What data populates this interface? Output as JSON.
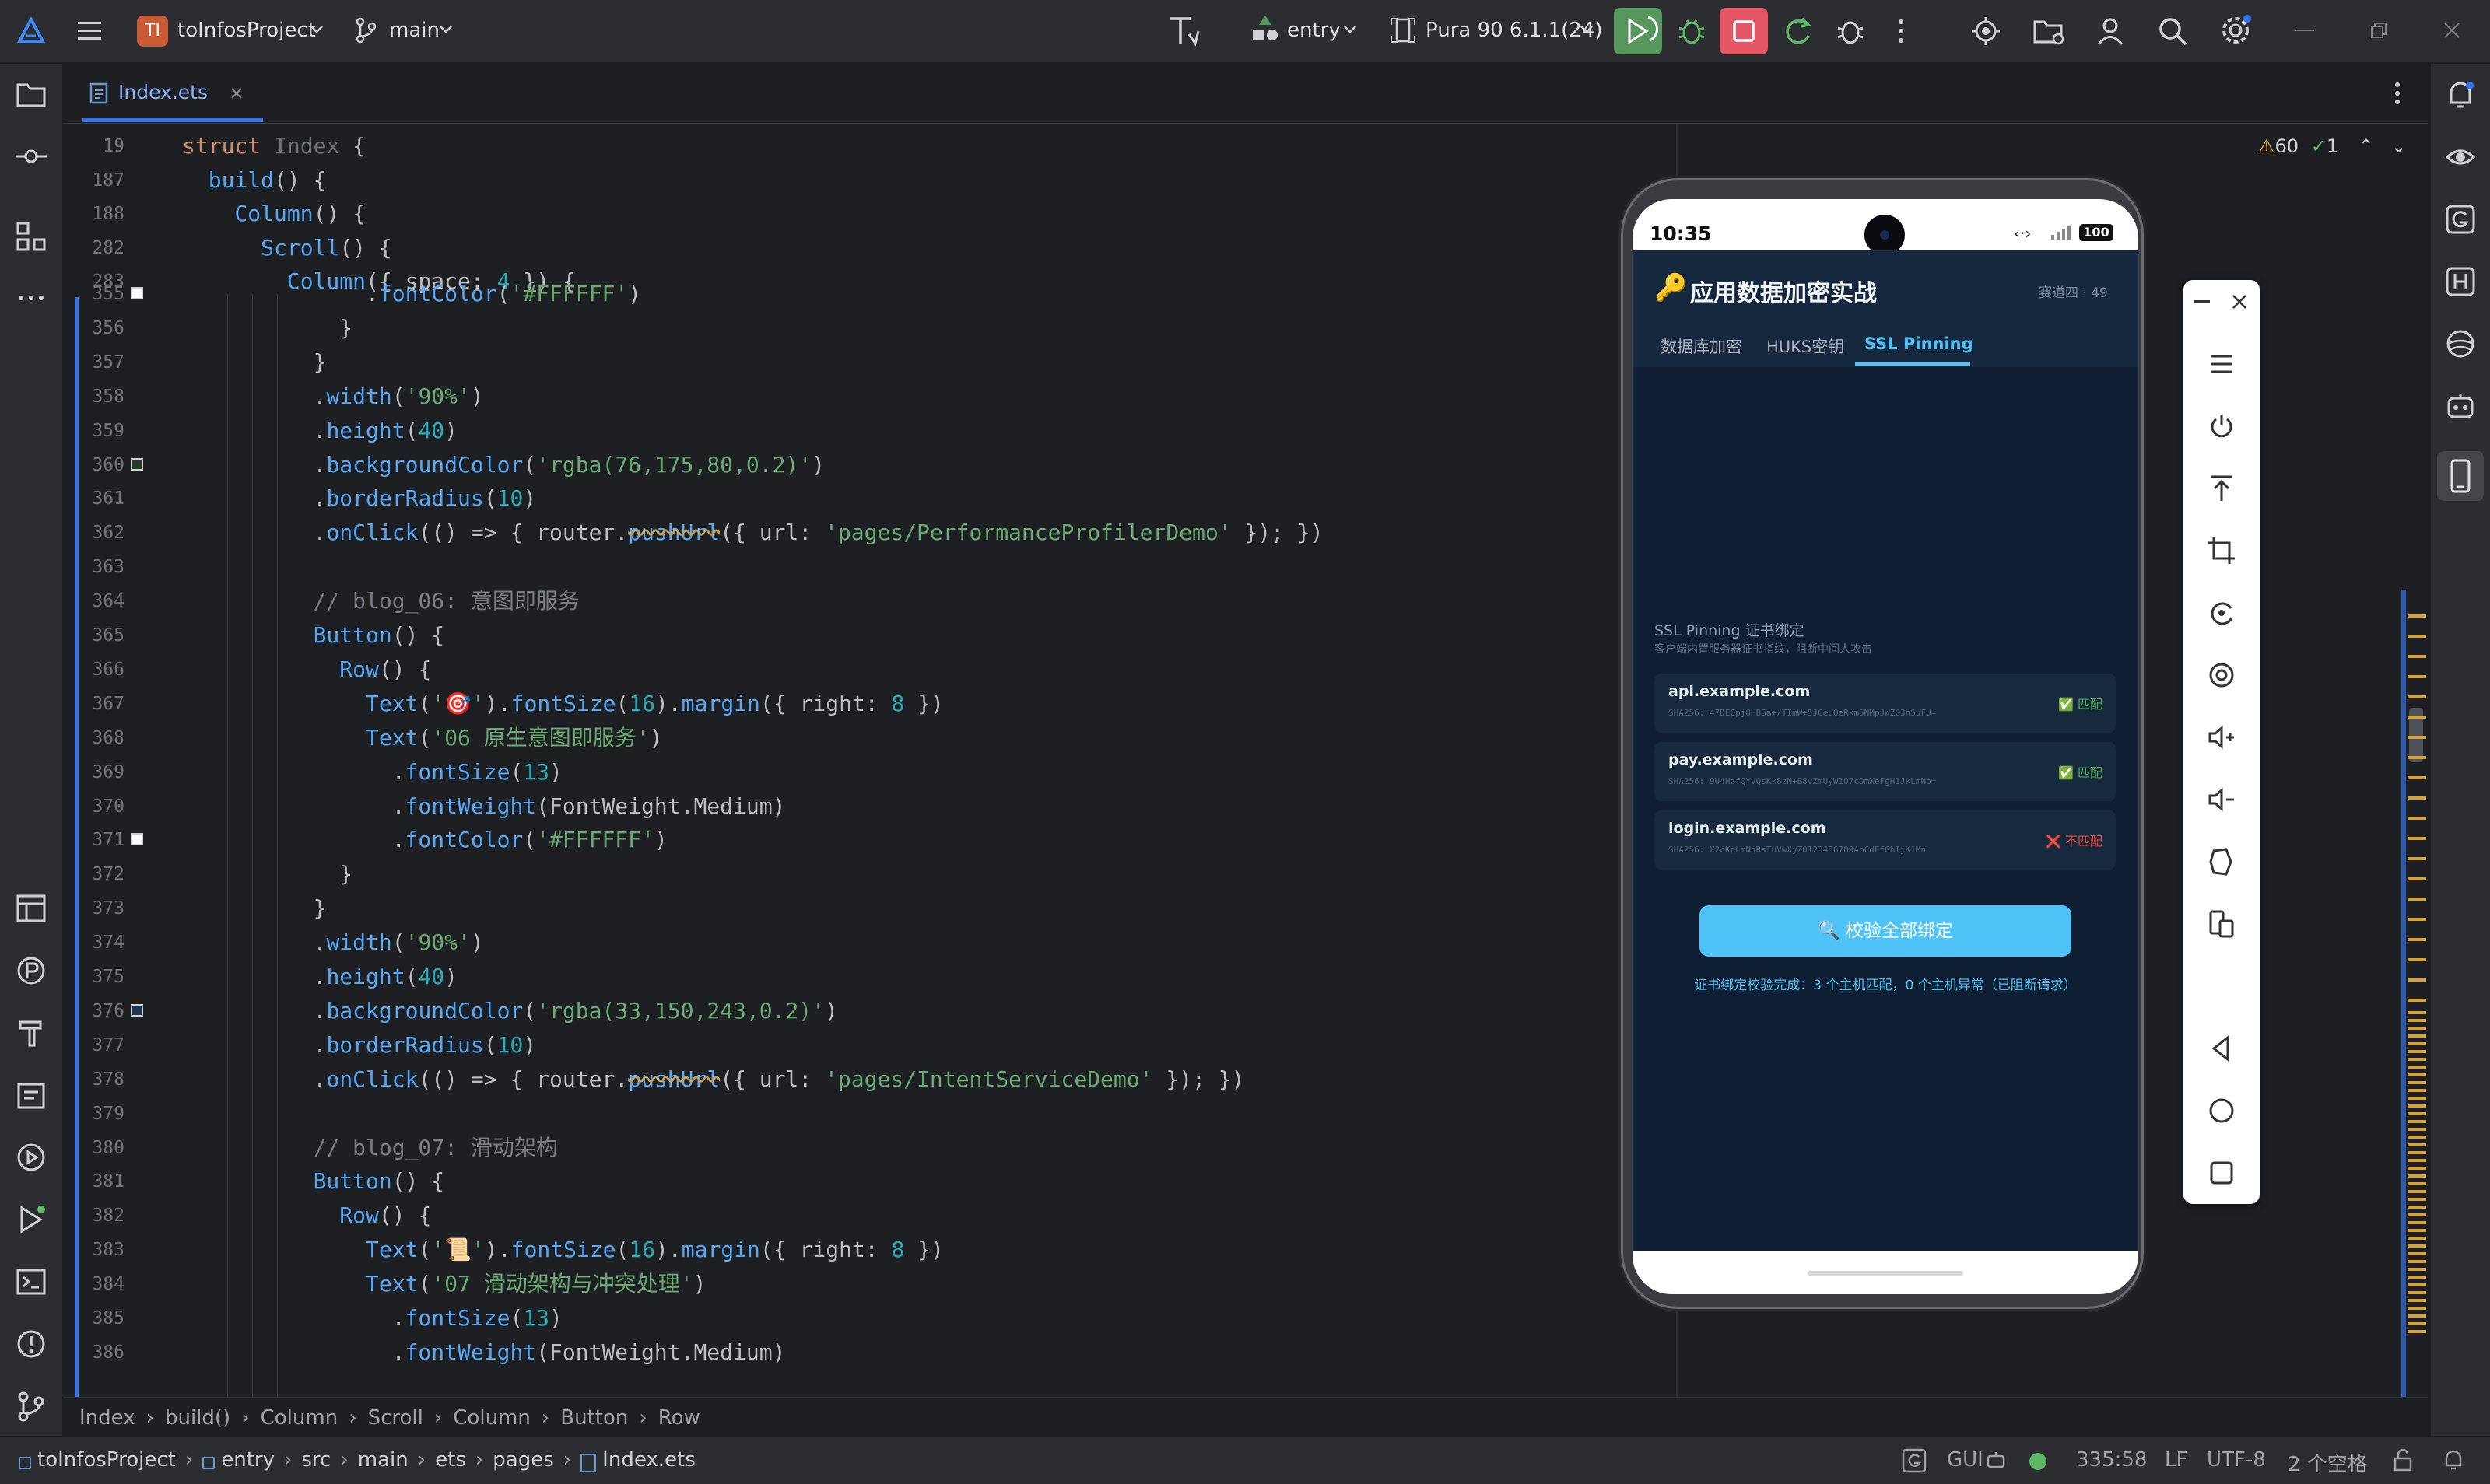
{
  "topbar": {
    "project_badge": "TI",
    "project_name": "toInfosProject",
    "branch": "main",
    "run_config": "entry",
    "device": "Pura 90 6.1.1(24)"
  },
  "editor_tab": {
    "filename": "Index.ets"
  },
  "inspections": {
    "warnings": "60",
    "ok": "1"
  },
  "sticky_lines": [
    {
      "num": "19",
      "parts": [
        [
          "kw",
          "struct "
        ],
        [
          "gr",
          "Index "
        ],
        [
          "",
          "{"
        ]
      ],
      "indent": 0
    },
    {
      "num": "187",
      "parts": [
        [
          "fn",
          "build"
        ],
        [
          "",
          "() {"
        ]
      ],
      "indent": 1
    },
    {
      "num": "188",
      "parts": [
        [
          "fn",
          "Column"
        ],
        [
          "",
          "() {"
        ]
      ],
      "indent": 2
    },
    {
      "num": "282",
      "parts": [
        [
          "fn",
          "Scroll"
        ],
        [
          "",
          "() {"
        ]
      ],
      "indent": 3
    },
    {
      "num": "283",
      "parts": [
        [
          "fn",
          "Column"
        ],
        [
          "",
          "({ space: "
        ],
        [
          "num",
          "4"
        ],
        [
          "",
          " }) {"
        ]
      ],
      "indent": 4
    }
  ],
  "code_lines": [
    {
      "num": "355",
      "parts": [
        [
          "",
          "      ."
        ],
        [
          "fn",
          "fontColor"
        ],
        [
          "",
          "("
        ],
        [
          "str",
          "'#FFFFFF'"
        ],
        [
          "",
          ")"
        ]
      ],
      "gutter": "white"
    },
    {
      "num": "356",
      "parts": [
        [
          "",
          "    }"
        ]
      ]
    },
    {
      "num": "357",
      "parts": [
        [
          "",
          "  }"
        ]
      ]
    },
    {
      "num": "358",
      "parts": [
        [
          "",
          "  ."
        ],
        [
          "fn",
          "width"
        ],
        [
          "",
          "("
        ],
        [
          "str",
          "'90%'"
        ],
        [
          "",
          ")"
        ]
      ]
    },
    {
      "num": "359",
      "parts": [
        [
          "",
          "  ."
        ],
        [
          "fn",
          "height"
        ],
        [
          "",
          "("
        ],
        [
          "num",
          "40"
        ],
        [
          "",
          ")"
        ]
      ]
    },
    {
      "num": "360",
      "parts": [
        [
          "",
          "  ."
        ],
        [
          "fn",
          "backgroundColor"
        ],
        [
          "",
          "("
        ],
        [
          "str",
          "'rgba(76,175,80,0.2)'"
        ],
        [
          "",
          ")"
        ]
      ],
      "gutter": "green"
    },
    {
      "num": "361",
      "parts": [
        [
          "",
          "  ."
        ],
        [
          "fn",
          "borderRadius"
        ],
        [
          "",
          "("
        ],
        [
          "num",
          "10"
        ],
        [
          "",
          ")"
        ]
      ]
    },
    {
      "num": "362",
      "parts": [
        [
          "",
          "  ."
        ],
        [
          "fn",
          "onClick"
        ],
        [
          "",
          "(() => { router."
        ],
        [
          "fn",
          "pushUrl"
        ],
        [
          "",
          "({ url: "
        ],
        [
          "str",
          "'pages/PerformanceProfilerDemo'"
        ],
        [
          "",
          " }); })"
        ]
      ]
    },
    {
      "num": "363",
      "parts": [
        [
          "",
          ""
        ]
      ]
    },
    {
      "num": "364",
      "parts": [
        [
          "cm",
          "  // blog_06: 意图即服务"
        ]
      ]
    },
    {
      "num": "365",
      "parts": [
        [
          "",
          "  "
        ],
        [
          "fn",
          "Button"
        ],
        [
          "",
          "() {"
        ]
      ]
    },
    {
      "num": "366",
      "parts": [
        [
          "",
          "    "
        ],
        [
          "fn",
          "Row"
        ],
        [
          "",
          "() {"
        ]
      ]
    },
    {
      "num": "367",
      "parts": [
        [
          "",
          "      "
        ],
        [
          "fn",
          "Text"
        ],
        [
          "",
          "("
        ],
        [
          "str",
          "'🎯'"
        ],
        [
          "",
          ")."
        ],
        [
          "fn",
          "fontSize"
        ],
        [
          "",
          "("
        ],
        [
          "num",
          "16"
        ],
        [
          "",
          ")."
        ],
        [
          "fn",
          "margin"
        ],
        [
          "",
          "({ right: "
        ],
        [
          "num",
          "8"
        ],
        [
          "",
          " })"
        ]
      ]
    },
    {
      "num": "368",
      "parts": [
        [
          "",
          "      "
        ],
        [
          "fn",
          "Text"
        ],
        [
          "",
          "("
        ],
        [
          "str",
          "'06 原生意图即服务'"
        ],
        [
          "",
          ")"
        ]
      ]
    },
    {
      "num": "369",
      "parts": [
        [
          "",
          "        ."
        ],
        [
          "fn",
          "fontSize"
        ],
        [
          "",
          "("
        ],
        [
          "num",
          "13"
        ],
        [
          "",
          ")"
        ]
      ]
    },
    {
      "num": "370",
      "parts": [
        [
          "",
          "        ."
        ],
        [
          "fn",
          "fontWeight"
        ],
        [
          "",
          "(FontWeight.Medium)"
        ]
      ]
    },
    {
      "num": "371",
      "parts": [
        [
          "",
          "        ."
        ],
        [
          "fn",
          "fontColor"
        ],
        [
          "",
          "("
        ],
        [
          "str",
          "'#FFFFFF'"
        ],
        [
          "",
          ")"
        ]
      ],
      "gutter": "white"
    },
    {
      "num": "372",
      "parts": [
        [
          "",
          "    }"
        ]
      ]
    },
    {
      "num": "373",
      "parts": [
        [
          "",
          "  }"
        ]
      ]
    },
    {
      "num": "374",
      "parts": [
        [
          "",
          "  ."
        ],
        [
          "fn",
          "width"
        ],
        [
          "",
          "("
        ],
        [
          "str",
          "'90%'"
        ],
        [
          "",
          ")"
        ]
      ]
    },
    {
      "num": "375",
      "parts": [
        [
          "",
          "  ."
        ],
        [
          "fn",
          "height"
        ],
        [
          "",
          "("
        ],
        [
          "num",
          "40"
        ],
        [
          "",
          ")"
        ]
      ]
    },
    {
      "num": "376",
      "parts": [
        [
          "",
          "  ."
        ],
        [
          "fn",
          "backgroundColor"
        ],
        [
          "",
          "("
        ],
        [
          "str",
          "'rgba(33,150,243,0.2)'"
        ],
        [
          "",
          ")"
        ]
      ],
      "gutter": "blue"
    },
    {
      "num": "377",
      "parts": [
        [
          "",
          "  ."
        ],
        [
          "fn",
          "borderRadius"
        ],
        [
          "",
          "("
        ],
        [
          "num",
          "10"
        ],
        [
          "",
          ")"
        ]
      ]
    },
    {
      "num": "378",
      "parts": [
        [
          "",
          "  ."
        ],
        [
          "fn",
          "onClick"
        ],
        [
          "",
          "(() => { router."
        ],
        [
          "fn",
          "pushUrl"
        ],
        [
          "",
          "({ url: "
        ],
        [
          "str",
          "'pages/IntentServiceDemo'"
        ],
        [
          "",
          " }); })"
        ]
      ]
    },
    {
      "num": "379",
      "parts": [
        [
          "",
          ""
        ]
      ]
    },
    {
      "num": "380",
      "parts": [
        [
          "cm",
          "  // blog_07: 滑动架构"
        ]
      ]
    },
    {
      "num": "381",
      "parts": [
        [
          "",
          "  "
        ],
        [
          "fn",
          "Button"
        ],
        [
          "",
          "() {"
        ]
      ]
    },
    {
      "num": "382",
      "parts": [
        [
          "",
          "    "
        ],
        [
          "fn",
          "Row"
        ],
        [
          "",
          "() {"
        ]
      ]
    },
    {
      "num": "383",
      "parts": [
        [
          "",
          "      "
        ],
        [
          "fn",
          "Text"
        ],
        [
          "",
          "("
        ],
        [
          "str",
          "'📜'"
        ],
        [
          "",
          ")."
        ],
        [
          "fn",
          "fontSize"
        ],
        [
          "",
          "("
        ],
        [
          "num",
          "16"
        ],
        [
          "",
          ")."
        ],
        [
          "fn",
          "margin"
        ],
        [
          "",
          "({ right: "
        ],
        [
          "num",
          "8"
        ],
        [
          "",
          " })"
        ]
      ]
    },
    {
      "num": "384",
      "parts": [
        [
          "",
          "      "
        ],
        [
          "fn",
          "Text"
        ],
        [
          "",
          "("
        ],
        [
          "str",
          "'07 滑动架构与冲突处理'"
        ],
        [
          "",
          ")"
        ]
      ]
    },
    {
      "num": "385",
      "parts": [
        [
          "",
          "        ."
        ],
        [
          "fn",
          "fontSize"
        ],
        [
          "",
          "("
        ],
        [
          "num",
          "13"
        ],
        [
          "",
          ")"
        ]
      ]
    },
    {
      "num": "386",
      "parts": [
        [
          "",
          "        ."
        ],
        [
          "fn",
          "fontWeight"
        ],
        [
          "",
          "(FontWeight.Medium)"
        ]
      ]
    }
  ],
  "breadcrumb": [
    "Index",
    "build()",
    "Column",
    "Scroll",
    "Column",
    "Button",
    "Row"
  ],
  "statusbar": {
    "path": [
      "toInfosProject",
      "entry",
      "src",
      "main",
      "ets",
      "pages",
      "Index.ets"
    ],
    "gui": "GUI",
    "position": "335:58",
    "line_sep": "LF",
    "encoding": "UTF-8",
    "indent": "2 个空格"
  },
  "phone": {
    "time": "10:35",
    "battery": "100",
    "app_title": "应用数据加密实战",
    "app_badge": "赛道四 · 49",
    "tabs": [
      "数据库加密",
      "HUKS密钥",
      "SSL Pinning"
    ],
    "active_tab": "SSL Pinning",
    "section_title": "SSL Pinning 证书绑定",
    "section_subtitle": "客户端内置服务器证书指纹，阻断中间人攻击",
    "hosts": [
      {
        "host": "api.example.com",
        "sha": "SHA256: 47DEQpj8HBSa+/TImW+5JCeuQeRkm5NMpJWZG3hSuFU=",
        "status": "匹配",
        "ok": true
      },
      {
        "host": "pay.example.com",
        "sha": "SHA256: 9U4HzfQYvQsKk8zN+B8vZmUyW1O7cDmXeFgH1JkLmNo=",
        "status": "匹配",
        "ok": true
      },
      {
        "host": "login.example.com",
        "sha": "SHA256: X2cKpLmNqRsTuVwXyZ0123456789AbCdEfGhIjK1Mn",
        "status": "不匹配",
        "ok": false
      }
    ],
    "verify_button": "校验全部绑定",
    "result_text": "证书绑定校验完成：3 个主机匹配，0 个主机异常（已阻断请求）"
  },
  "colors": {
    "accent": "#3574f0",
    "run_green": "#57965c",
    "stop_red": "#e55765",
    "phone_button": "#4fc3f7",
    "ok_green": "#4caf50",
    "bad_red": "#f44336"
  }
}
